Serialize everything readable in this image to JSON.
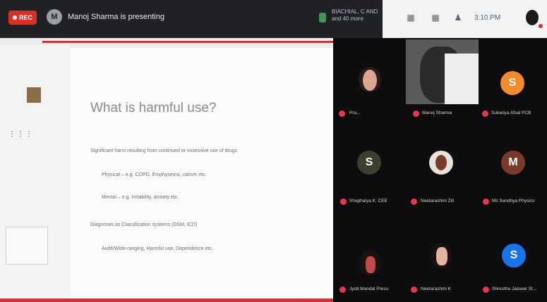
{
  "header": {
    "rec_label": "REC",
    "presenter_initial": "M",
    "presenting_text": "Manoj Sharma is presenting",
    "mini_tile_text": [
      "BIACHIAL, C AND",
      "and 40 more"
    ],
    "clock": "3:10 PM"
  },
  "slide": {
    "title": "What is harmful use?",
    "bullets": [
      "Significant harm resulting from continued or excessive use of drugs",
      "Physical – e.g. COPD, Emphysema, cancer etc.",
      "Mental – e.g. Irritability, anxiety etc.",
      "Diagnoses as Classification systems (DSM, ICD)",
      "Audit/Wide-ranging, Harmful use, Dependence etc."
    ]
  },
  "participants": [
    {
      "name": "Pra..."
    },
    {
      "name": "Manoj Sharma"
    },
    {
      "name": "Sukanya Afsal PCB",
      "initial": "S",
      "color": "#f28b2c"
    },
    {
      "name": "Shaphalya K. CEE",
      "initial": "S"
    },
    {
      "name": "Neetarashmi Zill"
    },
    {
      "name": "Ms Sandhya Physics",
      "initial": "M",
      "color": "#7a3a2a"
    },
    {
      "name": "Jyoti Mandal Press"
    },
    {
      "name": "Neetarashmi K"
    },
    {
      "name": "Shrestha Jaiswar St...",
      "initial": "S",
      "color": "#1a73e8"
    }
  ],
  "colors": {
    "accent_red": "#c1393f",
    "topbar": "#202124",
    "grid_bg": "#0d0d0f"
  }
}
